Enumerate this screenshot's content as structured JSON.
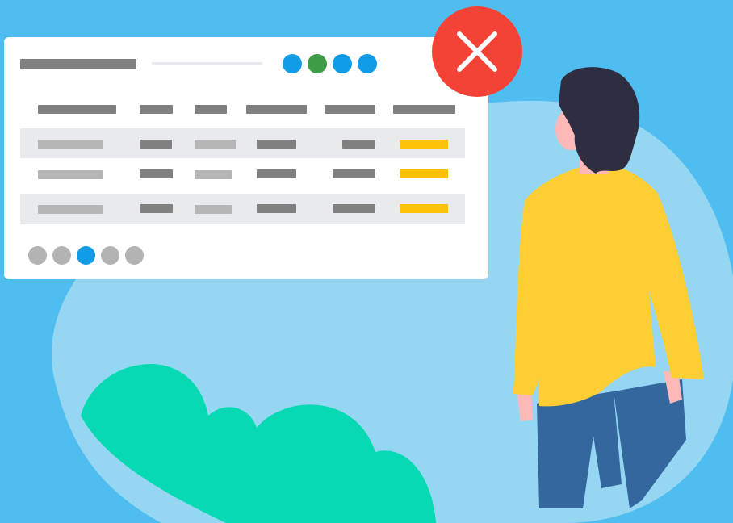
{
  "colors": {
    "background": "#4fbdef",
    "blob": "#95d7f3",
    "card": "#ffffff",
    "header_bar": "#808080",
    "cell_dark": "#808080",
    "cell_light": "#b6b6b6",
    "row_stripe": "#e9eaed",
    "status_accent": "#ffc107",
    "dot_active": "#129ce6",
    "dot_success": "#3d9c45",
    "dot_inactive": "#b3b3b3",
    "close_button": "#f44336",
    "bush": "#07d9b2",
    "shirt": "#ffce34",
    "pants": "#34679d",
    "hair": "#2f2e41",
    "skin": "#ffb8b8"
  },
  "icons": {
    "close": "close-x-icon",
    "person": "person-illustration",
    "bush": "bush-illustration"
  },
  "table": {
    "columns": 6,
    "rows": 3,
    "row_stripes": [
      true,
      false,
      true
    ],
    "status_column": "accent"
  },
  "status_dots": [
    "active",
    "success",
    "active",
    "active"
  ],
  "pagination": {
    "pages": 5,
    "current": 3
  }
}
